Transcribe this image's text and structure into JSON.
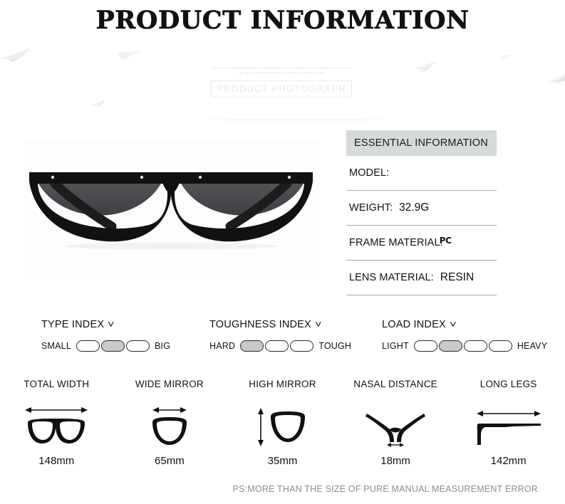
{
  "page": {
    "title": "PRODUCT INFORMATION",
    "footer_note": "PS:MORE THAN THE SIZE OF PURE MANUAL MEASUREMENT ERROR"
  },
  "photo_banner": {
    "watermark_line1": "365 SHOOT PHOTOGRAPHY DESIGN INDUSTRY LEADER ALL PICTURES ARE TAKEN",
    "watermark_line2": "BY 365 SHOOT COPYRIGHT DESIGN CONTACT WAY",
    "box_label": "PRODUCT PHOTOGRAPH"
  },
  "product_photo": {
    "alt": "half-rim cat-eye sunglasses, black frame, dark gray lenses",
    "frame_color": "#111111",
    "lens_color": "#4a4a4d"
  },
  "essential_info": {
    "header": "ESSENTIAL INFORMATION",
    "rows": [
      {
        "label": "MODEL:",
        "value": "",
        "style": "normal"
      },
      {
        "label": "WEIGHT:",
        "value": "32.9G",
        "style": "normal"
      },
      {
        "label": "FRAME MATERIAL:",
        "value": "PC",
        "style": "script"
      },
      {
        "label": "LENS MATERIAL:",
        "value": "RESIN",
        "style": "normal"
      }
    ]
  },
  "index_meters": [
    {
      "title": "TYPE INDEX",
      "left_label": "SMALL",
      "right_label": "BIG",
      "segments": 3,
      "active": 2
    },
    {
      "title": "TOUGHNESS INDEX",
      "left_label": "HARD",
      "right_label": "TOUGH",
      "segments": 3,
      "active": 1
    },
    {
      "title": "LOAD INDEX",
      "left_label": "LIGHT",
      "right_label": "HEAVY",
      "segments": 4,
      "active": 2
    }
  ],
  "measurements": [
    {
      "label": "TOTAL WIDTH",
      "value": "148mm",
      "icon": "total-width-icon"
    },
    {
      "label": "WIDE MIRROR",
      "value": "65mm",
      "icon": "wide-mirror-icon"
    },
    {
      "label": "HIGH MIRROR",
      "value": "35mm",
      "icon": "high-mirror-icon"
    },
    {
      "label": "NASAL DISTANCE",
      "value": "18mm",
      "icon": "nasal-distance-icon"
    },
    {
      "label": "LONG LEGS",
      "value": "142mm",
      "icon": "long-legs-icon"
    }
  ],
  "colors": {
    "header_bg": "#d5dadb",
    "rule": "#a9a9a9",
    "pill_on": "#c9c9c9",
    "footer_text": "#8d8d8d"
  }
}
